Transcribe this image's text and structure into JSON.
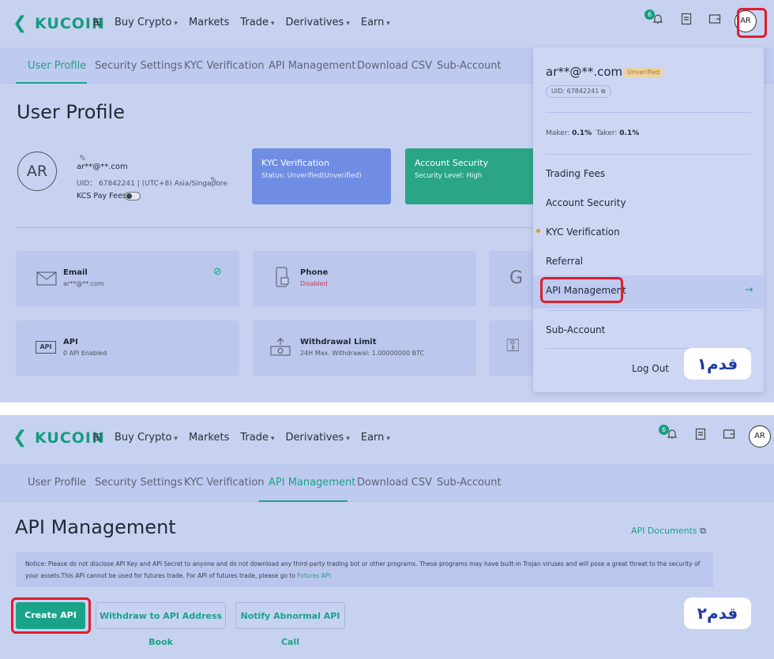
{
  "header": {
    "brand": "KUCOIN",
    "nav": [
      "Buy Crypto",
      "Markets",
      "Trade",
      "Derivatives",
      "Earn"
    ],
    "notification_count": "6",
    "avatar": "AR"
  },
  "subtabs": [
    "User Profile",
    "Security Settings",
    "KYC Verification",
    "API Management",
    "Download CSV",
    "Sub-Account"
  ],
  "profile": {
    "title": "User Profile",
    "avatar": "AR",
    "email": "ar**@**.com",
    "uid_line": "UID： 67842241 | (UTC+8) Asia/Singapore",
    "kcs_label": "KCS Pay Fees",
    "kyc": {
      "title": "KYC Verification",
      "status": "Status: Unverified(Unverified)"
    },
    "security": {
      "title": "Account Security",
      "level": "Security Level: High"
    },
    "email_card": {
      "title": "Email",
      "value": "ar**@**.com"
    },
    "phone_card": {
      "title": "Phone",
      "value": "Disabled"
    },
    "api_card": {
      "icon_text": "API",
      "title": "API",
      "value": "0 API Enabled"
    },
    "withdraw_card": {
      "title": "Withdrawal Limit",
      "value": "24H Max. Withdrawal: 1.00000000 BTC"
    }
  },
  "dropdown": {
    "email": "ar**@**.com",
    "status_badge": "Unverified",
    "uid": "UID: 67842241",
    "maker_label": "Maker:",
    "maker_value": "0.1%",
    "taker_label": "Taker:",
    "taker_value": "0.1%",
    "items": [
      "Trading Fees",
      "Account Security",
      "KYC Verification",
      "Referral",
      "API Management",
      "Sub-Account"
    ],
    "logout": "Log Out",
    "arrow": "→"
  },
  "step1": "قدم۱",
  "step2": "قدم۲",
  "api_page": {
    "title": "API Management",
    "docs_link": "API Documents",
    "notice": "Notice: Please do not disclose API Key and API Secret to anyone and do not download any third-party trading bot or other programs. These programs may have built-in Trojan viruses and will pose a great threat to the security of your assets.This API cannot be used for futures trade. For API of futures trade, please go to",
    "notice_link": "Futures API.",
    "btn_create": "Create API",
    "btn_withdraw": "Withdraw to API Address Book",
    "btn_notify": "Notify Abnormal API Call"
  },
  "colors": {
    "accent": "#1aa389",
    "highlight": "#e11d2a",
    "kyc_card": "#6f8ee3",
    "security_card": "#2aa585"
  }
}
